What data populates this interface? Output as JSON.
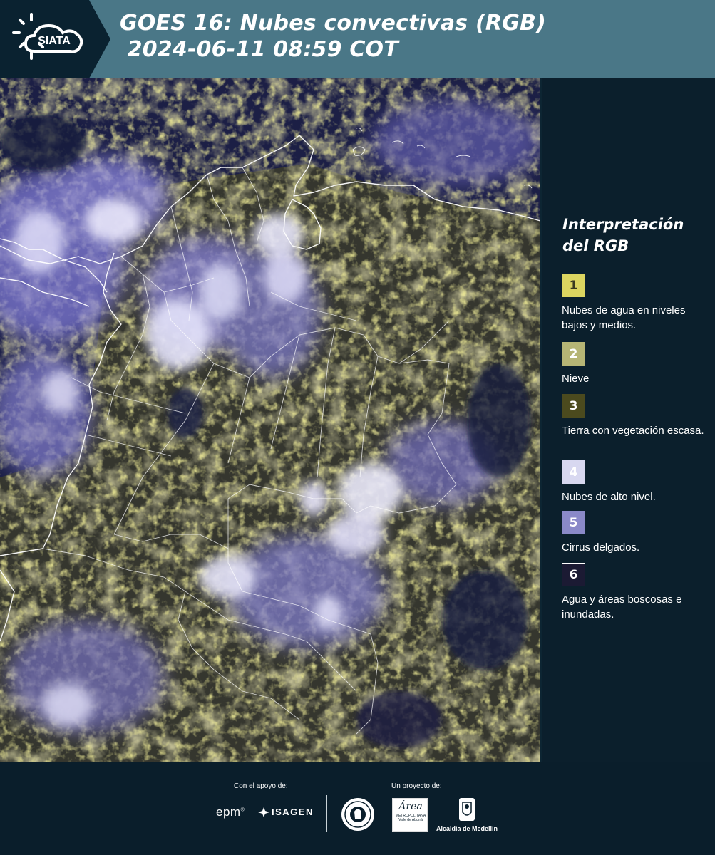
{
  "header": {
    "logo_text": "SIATA",
    "title_line1": "GOES 16: Nubes convectivas (RGB)",
    "title_line2": " 2024-06-11 08:59 COT"
  },
  "legend": {
    "title": "Interpretación del RGB",
    "items": [
      {
        "number": "1",
        "label": "Nubes de agua en niveles bajos y medios.",
        "color": "#dcd560",
        "text_color": "#3a3a20"
      },
      {
        "number": "2",
        "label": "Nieve",
        "color": "#b6b575",
        "text_color": "#ffffff"
      },
      {
        "number": "3",
        "label": "Tierra con vegetación escasa.",
        "color": "#4b4a1e",
        "text_color": "#ffffff"
      },
      {
        "number": "4",
        "label": "Nubes de alto nivel.",
        "color": "#d8d8f0",
        "text_color": "#ffffff"
      },
      {
        "number": "5",
        "label": "Cirrus delgados.",
        "color": "#8a89c8",
        "text_color": "#ffffff"
      },
      {
        "number": "6",
        "label": "Agua y áreas boscosas e inundadas.",
        "color": "#1b1a33",
        "text_color": "#ffffff"
      }
    ]
  },
  "footer": {
    "support_label": "Con el apoyo de:",
    "project_label": "Un proyecto de:",
    "sponsor_epm": "epm",
    "sponsor_isagen": "ISAGEN",
    "area_logo_text": "Área",
    "area_sub1": "METROPOLITANA",
    "area_sub2": "Valle de Aburrá",
    "alcaldia": "Alcaldía de Medellín"
  },
  "colors": {
    "header_bg": "#4a7787",
    "page_bg": "#0a1e2b",
    "cloud_low": "#d4cf55",
    "cloud_high": "#e6e6fa",
    "cirrus": "#8c86d8",
    "ocean": "#1a1f47"
  }
}
